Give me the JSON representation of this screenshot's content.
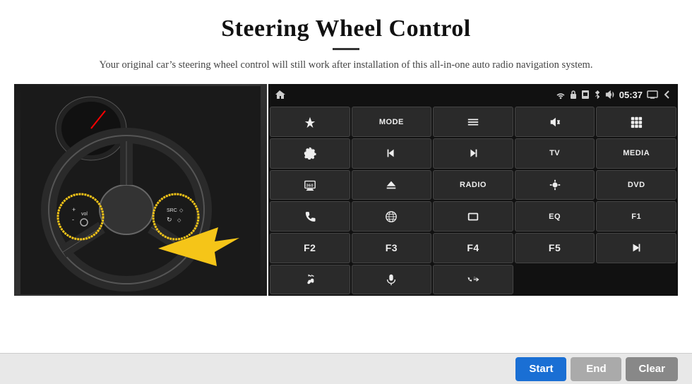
{
  "header": {
    "title": "Steering Wheel Control",
    "subtitle": "Your original car’s steering wheel control will still work after installation of this all-in-one auto radio navigation system."
  },
  "statusBar": {
    "time": "05:37",
    "icons": [
      "wifi",
      "lock",
      "sim",
      "bluetooth",
      "screen",
      "back"
    ]
  },
  "buttons": [
    {
      "id": "home",
      "label": "",
      "icon": "home"
    },
    {
      "id": "mode",
      "label": "MODE",
      "icon": ""
    },
    {
      "id": "list",
      "label": "",
      "icon": "list"
    },
    {
      "id": "mute",
      "label": "",
      "icon": "mute"
    },
    {
      "id": "apps",
      "label": "",
      "icon": "apps"
    },
    {
      "id": "settings",
      "label": "",
      "icon": "settings"
    },
    {
      "id": "prev",
      "label": "",
      "icon": "prev"
    },
    {
      "id": "next",
      "label": "",
      "icon": "next"
    },
    {
      "id": "tv",
      "label": "TV",
      "icon": ""
    },
    {
      "id": "media",
      "label": "MEDIA",
      "icon": ""
    },
    {
      "id": "360",
      "label": "",
      "icon": "360"
    },
    {
      "id": "eject",
      "label": "",
      "icon": "eject"
    },
    {
      "id": "radio",
      "label": "RADIO",
      "icon": ""
    },
    {
      "id": "brightness",
      "label": "",
      "icon": "brightness"
    },
    {
      "id": "dvd",
      "label": "DVD",
      "icon": ""
    },
    {
      "id": "phone",
      "label": "",
      "icon": "phone"
    },
    {
      "id": "browser",
      "label": "",
      "icon": "browser"
    },
    {
      "id": "rect",
      "label": "",
      "icon": "rect"
    },
    {
      "id": "eq",
      "label": "EQ",
      "icon": ""
    },
    {
      "id": "f1",
      "label": "F1",
      "icon": ""
    },
    {
      "id": "f2",
      "label": "F2",
      "icon": ""
    },
    {
      "id": "f3",
      "label": "F3",
      "icon": ""
    },
    {
      "id": "f4",
      "label": "F4",
      "icon": ""
    },
    {
      "id": "f5",
      "label": "F5",
      "icon": ""
    },
    {
      "id": "playpause",
      "label": "",
      "icon": "playpause"
    },
    {
      "id": "music",
      "label": "",
      "icon": "music"
    },
    {
      "id": "mic",
      "label": "",
      "icon": "mic"
    },
    {
      "id": "call",
      "label": "",
      "icon": "call"
    }
  ],
  "bottomBar": {
    "startLabel": "Start",
    "endLabel": "End",
    "clearLabel": "Clear"
  }
}
